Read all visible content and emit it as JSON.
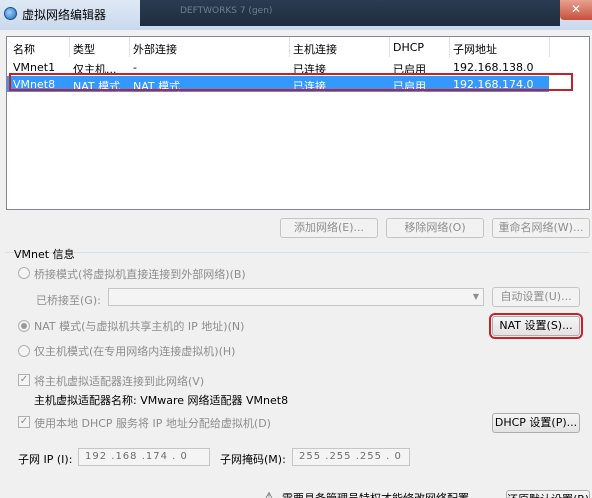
{
  "window": {
    "title": "虚拟网络编辑器",
    "close_glyph": "✕",
    "blurred_tab": "DEFTWORKS 7 (gen)"
  },
  "table": {
    "columns": [
      "名称",
      "类型",
      "外部连接",
      "主机连接",
      "DHCP",
      "子网地址"
    ],
    "rows": [
      {
        "name": "VMnet1",
        "type": "仅主机...",
        "external": "-",
        "host": "已连接",
        "dhcp": "已启用",
        "subnet": "192.168.138.0"
      },
      {
        "name": "VMnet8",
        "type": "NAT 模式",
        "external": "NAT 模式",
        "host": "已连接",
        "dhcp": "已启用",
        "subnet": "192.168.174.0"
      }
    ],
    "selected_index": 1
  },
  "actions": {
    "add": "添加网络(E)...",
    "remove": "移除网络(O)",
    "rename": "重命名网络(W)..."
  },
  "info": {
    "group_title": "VMnet 信息",
    "bridge_mode": "桥接模式(将虚拟机直接连接到外部网络)(B)",
    "bridged_to_label": "已桥接至(G):",
    "auto_settings": "自动设置(U)...",
    "nat_mode": "NAT 模式(与虚拟机共享主机的 IP 地址)(N)",
    "nat_settings": "NAT 设置(S)...",
    "host_only_mode": "仅主机模式(在专用网络内连接虚拟机)(H)",
    "connect_adapter": "将主机虚拟适配器连接到此网络(V)",
    "adapter_name_label": "主机虚拟适配器名称: VMware 网络适配器 VMnet8",
    "use_dhcp": "使用本地 DHCP 服务将 IP 地址分配给虚拟机(D)",
    "dhcp_settings": "DHCP 设置(P)...",
    "subnet_ip_label": "子网 IP (I):",
    "subnet_ip_value": "192 .168 .174 . 0",
    "subnet_mask_label": "子网掩码(M):",
    "subnet_mask_value": "255 .255 .255 . 0",
    "selected_mode": "nat",
    "connect_adapter_checked": true,
    "use_dhcp_checked": true
  },
  "footer": {
    "warning_text": "需要具备管理员特权才能修改网络配置。",
    "restore_button": "还原默认设置(R)"
  },
  "colors": {
    "selection": "#3399ff",
    "highlight_outline": "#c8202a"
  }
}
